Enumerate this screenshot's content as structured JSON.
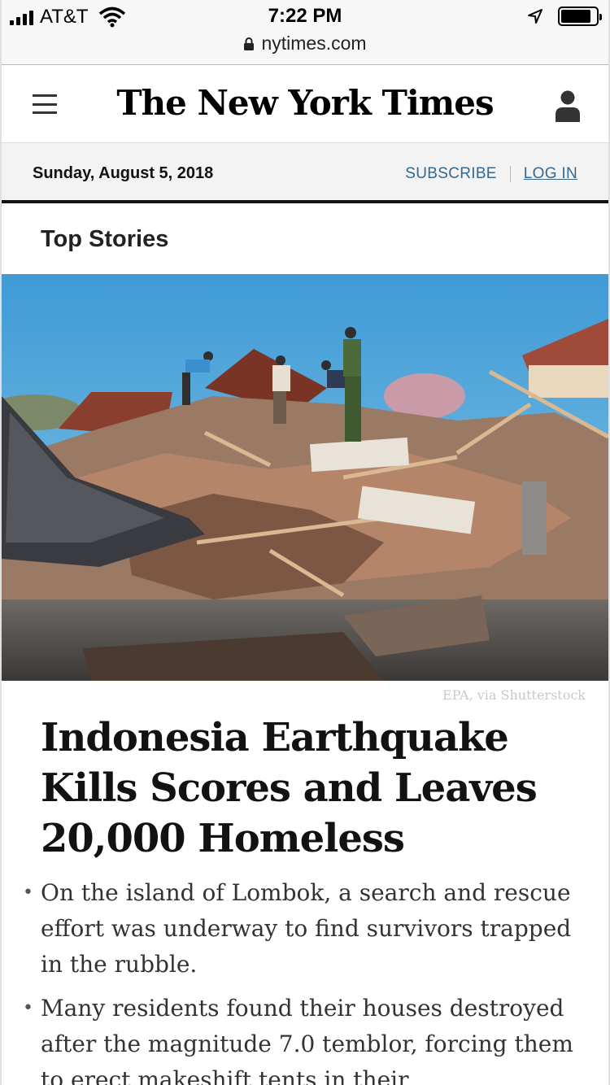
{
  "statusbar": {
    "carrier": "AT&T",
    "time": "7:22 PM",
    "url": "nytimes.com"
  },
  "masthead": {
    "logo_text": "The New York Times"
  },
  "datebar": {
    "date": "Sunday, August 5, 2018",
    "subscribe_label": "SUBSCRIBE",
    "login_label": "LOG IN"
  },
  "section": {
    "title": "Top Stories"
  },
  "story": {
    "image_credit": "EPA, via Shutterstock",
    "headline": "Indonesia Earthquake Kills Scores and Leaves 20,000 Homeless",
    "summary": [
      "On the island of Lombok, a search and rescue effort was underway to find survivors trapped in the rubble.",
      "Many residents found their houses destroyed after the magnitude 7.0 temblor, forcing them to erect makeshift tents in their"
    ]
  },
  "colors": {
    "link": "#326891",
    "sky": "#4aa3d8",
    "text": "#121212"
  },
  "icons": [
    "signal-icon",
    "wifi-icon",
    "lock-icon",
    "location-arrow-icon",
    "battery-icon",
    "hamburger-menu-icon",
    "user-account-icon"
  ]
}
